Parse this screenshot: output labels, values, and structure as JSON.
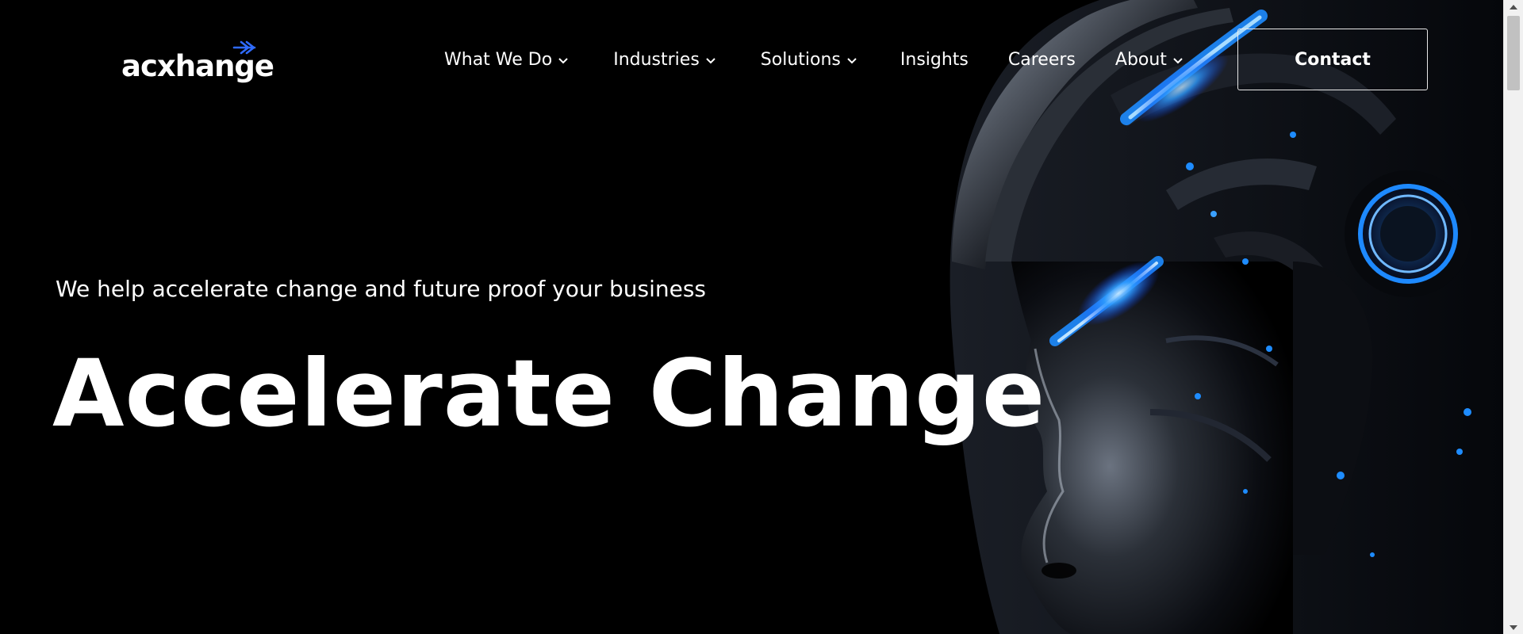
{
  "brand": {
    "name": "acxhange",
    "accent": "#2f6bff"
  },
  "nav": {
    "items": [
      {
        "label": "What We Do",
        "dropdown": true
      },
      {
        "label": "Industries",
        "dropdown": true
      },
      {
        "label": "Solutions",
        "dropdown": true
      },
      {
        "label": "Insights",
        "dropdown": false
      },
      {
        "label": "Careers",
        "dropdown": false
      },
      {
        "label": "About",
        "dropdown": true
      }
    ],
    "contact_label": "Contact"
  },
  "hero": {
    "tagline": "We help accelerate change and future proof your business",
    "headline": "Accelerate Change"
  },
  "colors": {
    "background": "#000000",
    "text": "#ffffff",
    "glow": "#1e8cff"
  }
}
